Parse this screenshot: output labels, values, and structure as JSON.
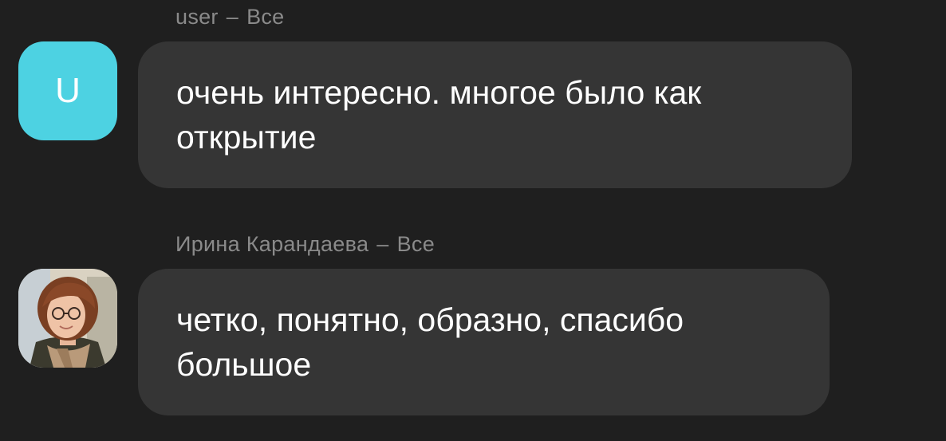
{
  "messages": [
    {
      "author": "user",
      "separator": "–",
      "audience": "Все",
      "avatar": {
        "type": "initial",
        "initial": "U",
        "color": "#4dd2e2"
      },
      "text": "очень интересно. многое было как открытие"
    },
    {
      "author": "Ирина Карандаева",
      "separator": "–",
      "audience": "Все",
      "avatar": {
        "type": "photo",
        "icon": "user-photo-icon"
      },
      "text": "четко, понятно, образно, спасибо большое"
    }
  ],
  "colors": {
    "background": "#1f1f1f",
    "bubble": "#353535",
    "header_text": "#8a8a8a",
    "message_text": "#ffffff"
  }
}
